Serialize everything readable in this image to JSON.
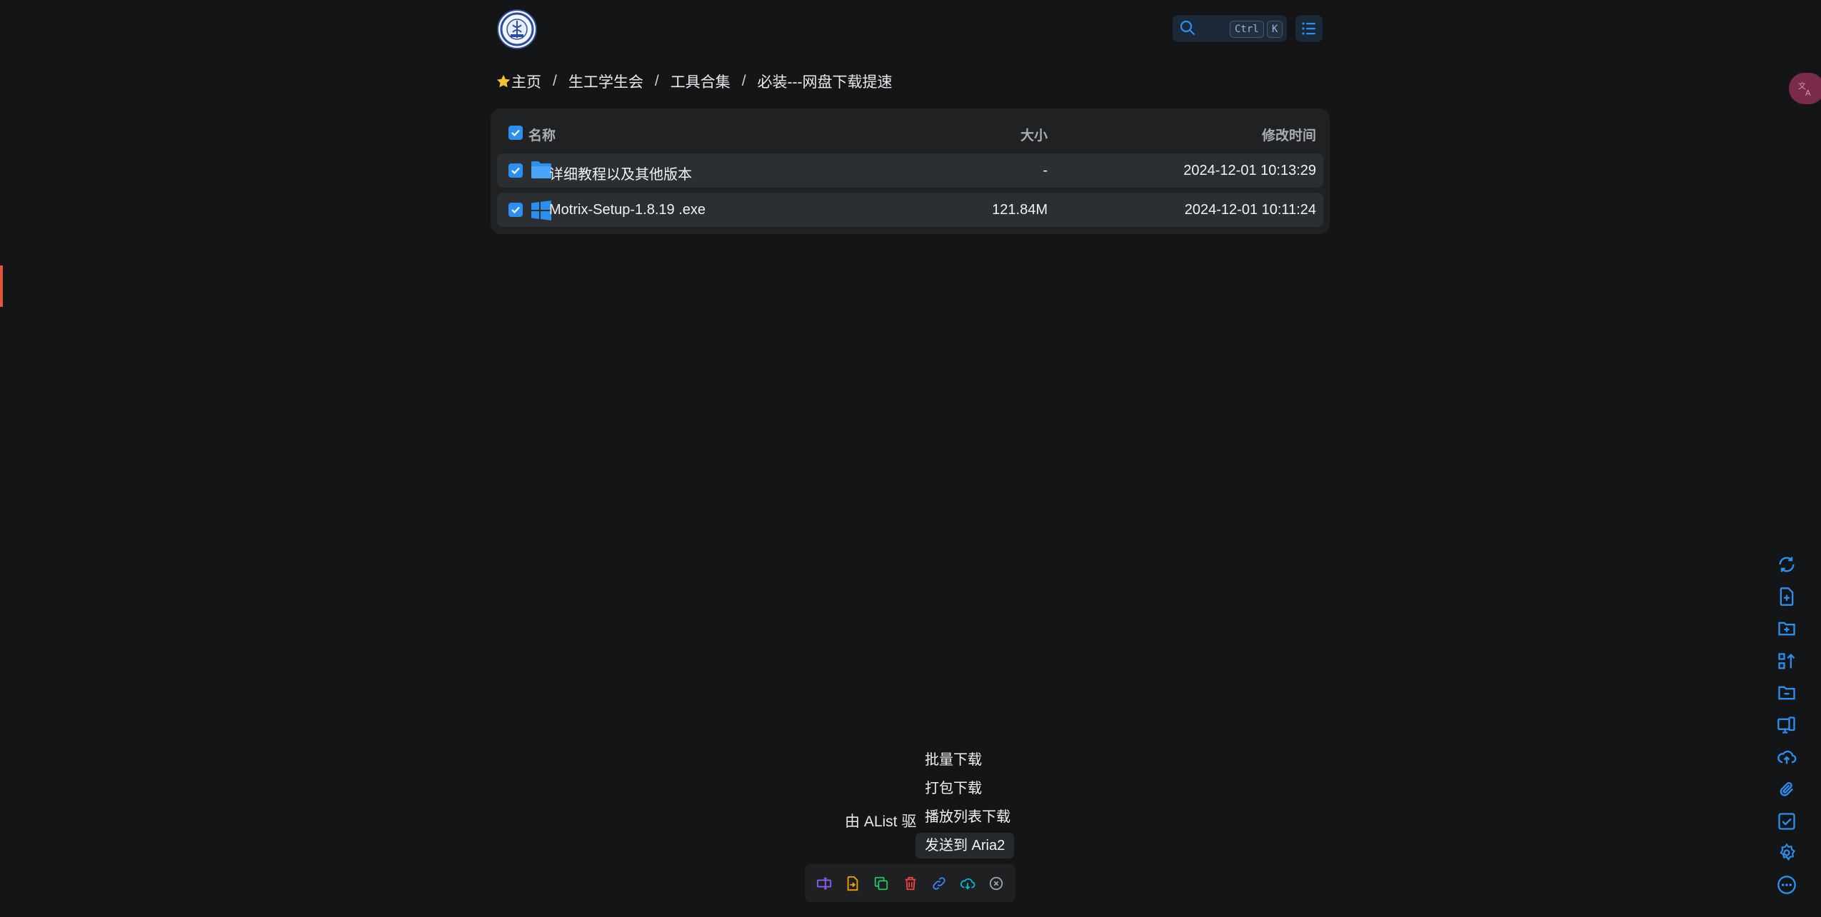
{
  "header": {
    "logo_name": "club-logo",
    "search": {
      "kbd_ctrl": "Ctrl",
      "kbd_k": "K"
    }
  },
  "breadcrumb": {
    "items": [
      "主页",
      "生工学生会",
      "工具合集",
      "必装---网盘下载提速"
    ],
    "separator": "/"
  },
  "file_list": {
    "columns": {
      "name": "名称",
      "size": "大小",
      "modified": "修改时间"
    },
    "rows": [
      {
        "name": "详细教程以及其他版本",
        "size": "-",
        "modified": "2024-12-01 10:13:29",
        "icon": "folder-icon",
        "checked": true
      },
      {
        "name": "Motrix-Setup-1.8.19 .exe",
        "size": "121.84M",
        "modified": "2024-12-01 10:11:24",
        "icon": "windows-icon",
        "checked": true
      }
    ]
  },
  "footer": {
    "powered_by": "由 AList 驱"
  },
  "download_menu": {
    "items": [
      "批量下载",
      "打包下载",
      "播放列表下载",
      "发送到 Aria2"
    ],
    "highlighted_index": 3
  },
  "right_toolbar": [
    "refresh-icon",
    "new-file-icon",
    "new-folder-icon",
    "sort-icon",
    "folder-icon",
    "local-settings-icon",
    "upload-icon",
    "offline-download-icon",
    "toggle-checkbox-icon",
    "settings-icon",
    "more-icon"
  ],
  "action_bar": [
    "rename-icon",
    "move-icon",
    "copy-icon",
    "delete-icon",
    "copy-link-icon",
    "download-icon",
    "cancel-select-icon"
  ],
  "colors": {
    "accent": "#2b8ff0",
    "background": "#131517",
    "card": "#1f2123"
  }
}
